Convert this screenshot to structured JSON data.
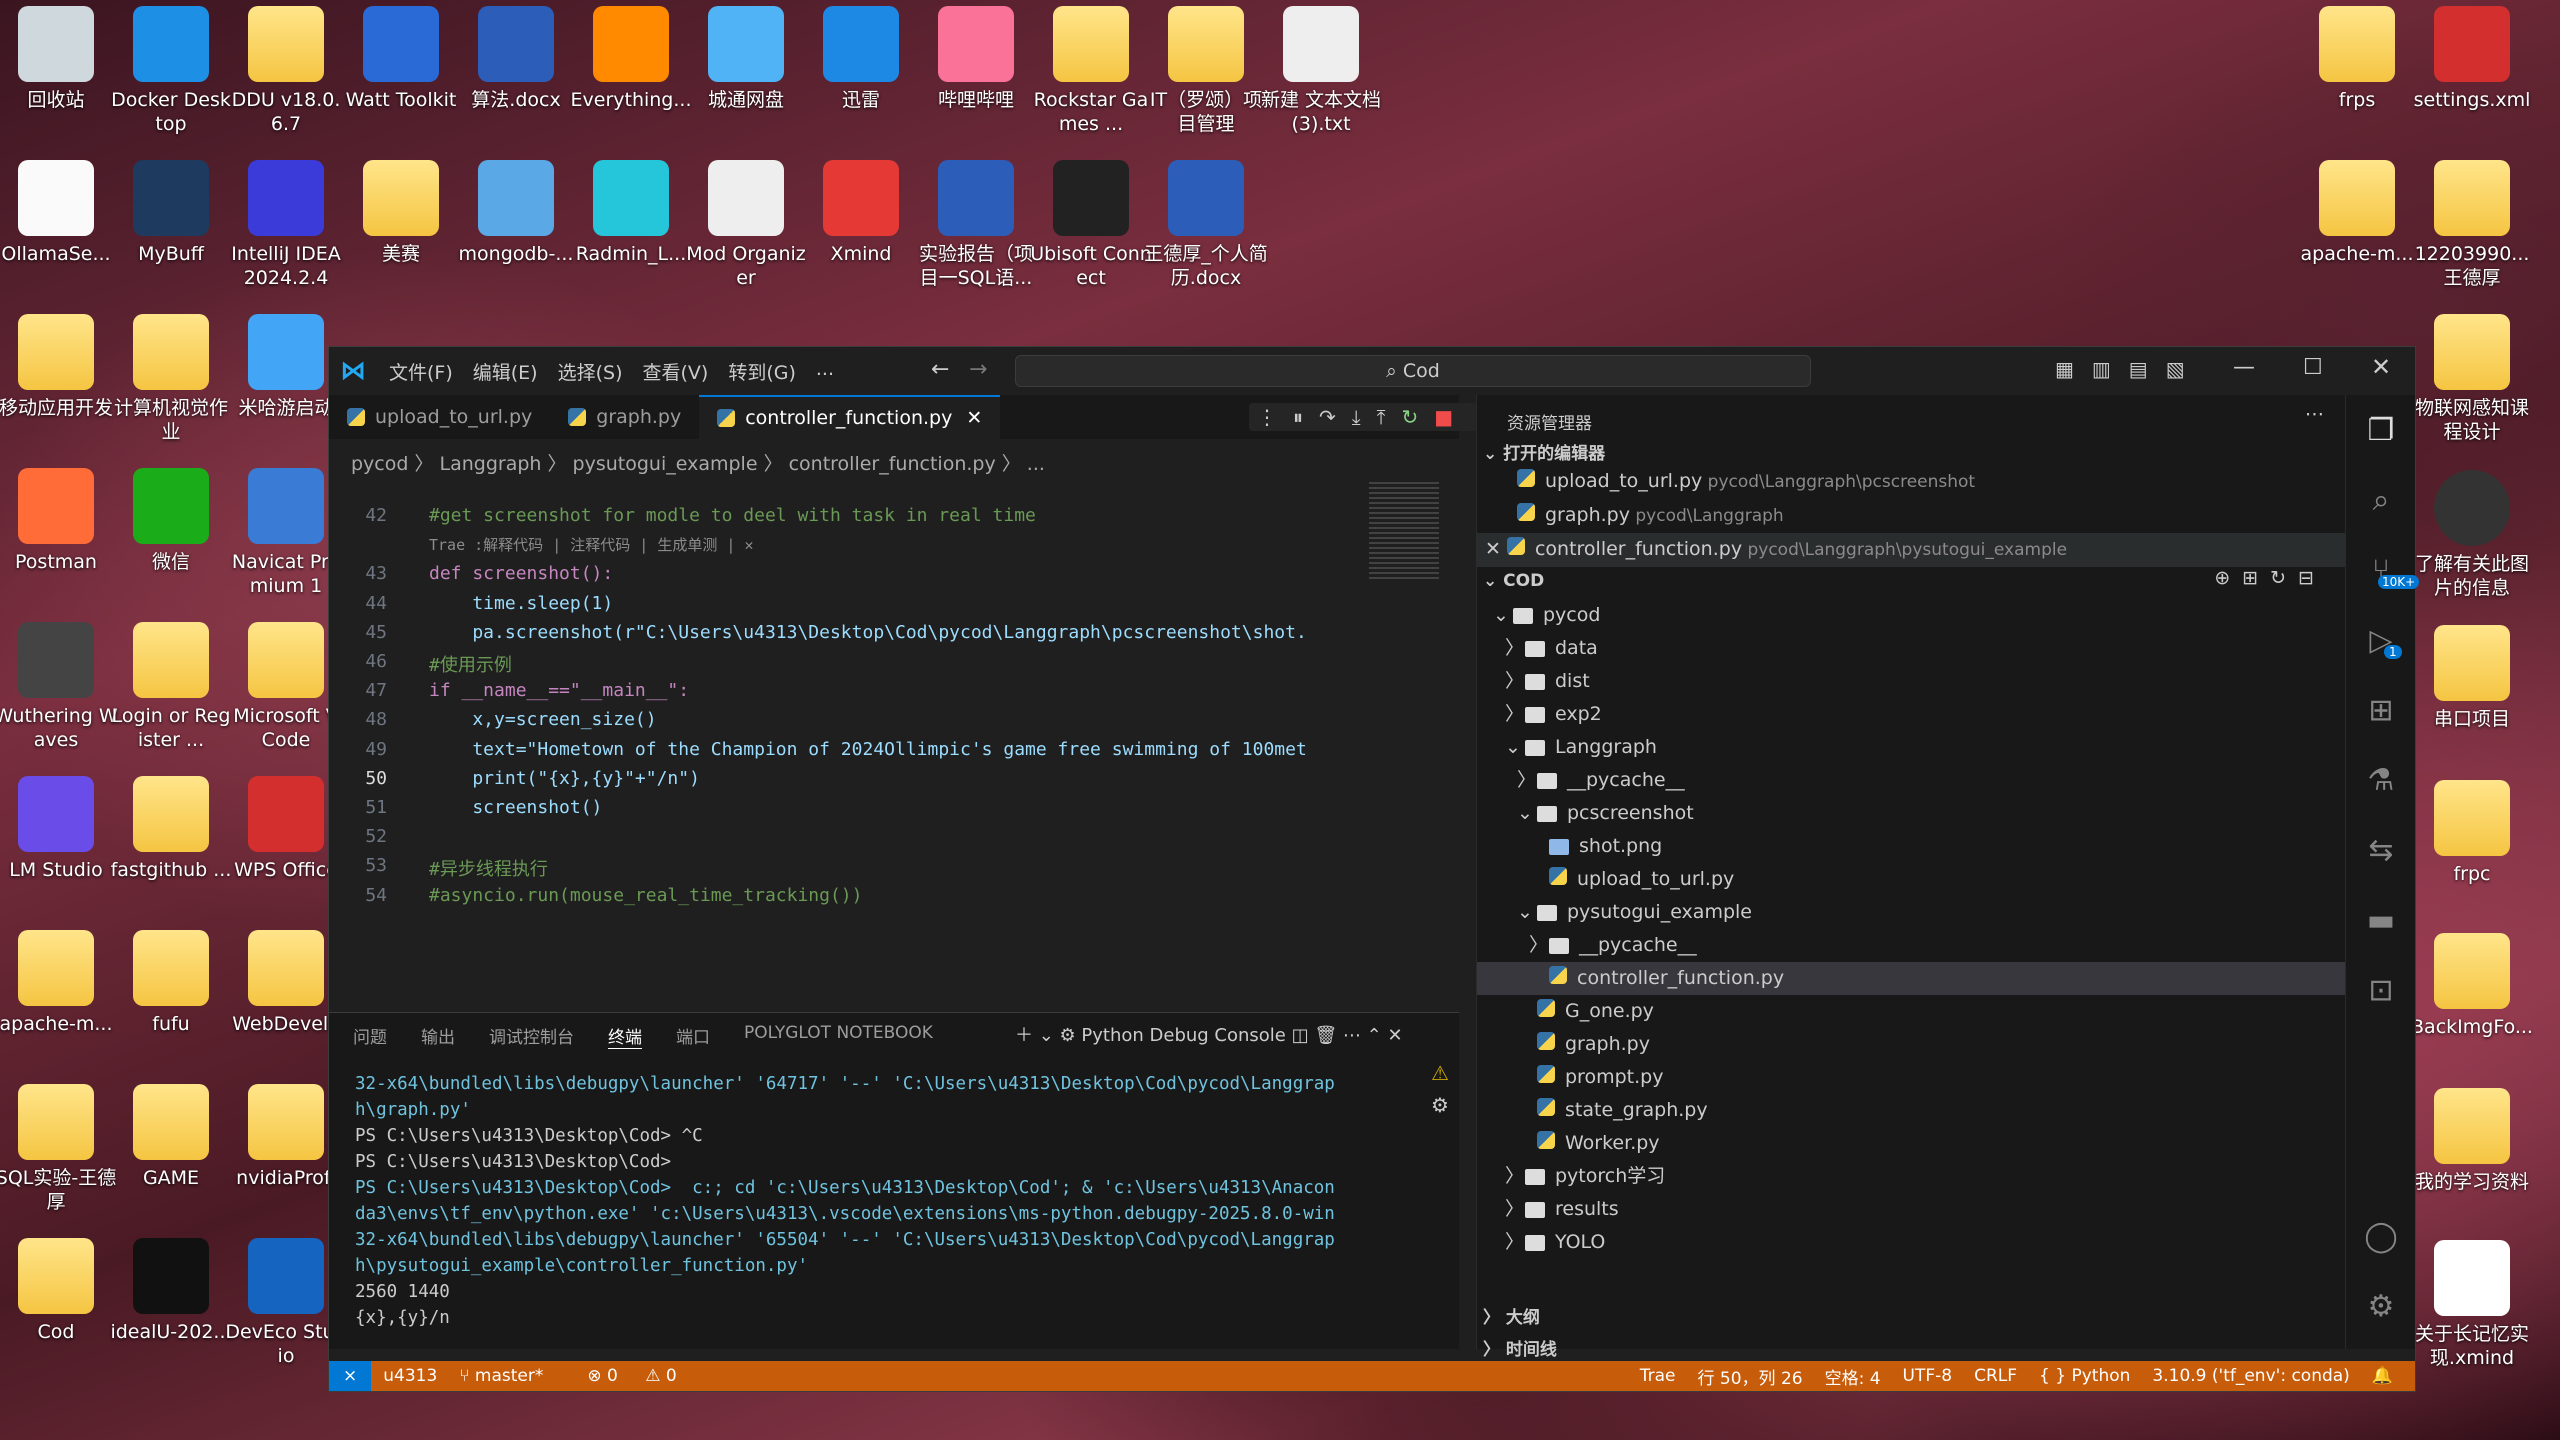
{
  "desktop": {
    "left_icons": [
      {
        "label": "回收站",
        "x": 0,
        "y": 0
      },
      {
        "label": "Docker Desktop"
      },
      {
        "label": "DDU v18.0.6.7"
      },
      {
        "label": "Watt Toolkit"
      },
      {
        "label": "算法.docx"
      },
      {
        "label": "Everything..."
      },
      {
        "label": "城通网盘"
      },
      {
        "label": "迅雷"
      },
      {
        "label": "哔哩哔哩"
      },
      {
        "label": "Rockstar Games ..."
      },
      {
        "label": "IT（罗颂）项目管理"
      },
      {
        "label": "新建 文本文档 (3).txt"
      },
      {
        "label": "OllamaSe..."
      },
      {
        "label": "MyBuff"
      },
      {
        "label": "IntelliJ IDEA 2024.2.4"
      },
      {
        "label": "美赛"
      },
      {
        "label": "mongodb-..."
      },
      {
        "label": "Radmin_L..."
      },
      {
        "label": "Mod Organizer"
      },
      {
        "label": "Xmind"
      },
      {
        "label": "实验报告（项目一SQL语..."
      },
      {
        "label": "Ubisoft Connect"
      },
      {
        "label": "王德厚_个人简历.docx"
      },
      {
        "label": "移动应用开发"
      },
      {
        "label": "计算机视觉作业"
      },
      {
        "label": "米哈游启动"
      },
      {
        "label": "Postman"
      },
      {
        "label": "微信"
      },
      {
        "label": "Navicat Premium 1"
      },
      {
        "label": "Wuthering Waves"
      },
      {
        "label": "Login or Register ..."
      },
      {
        "label": "Microsoft V Code"
      },
      {
        "label": "LM Studio"
      },
      {
        "label": "fastgithub ..."
      },
      {
        "label": "WPS Office"
      },
      {
        "label": "apache-m..."
      },
      {
        "label": "fufu"
      },
      {
        "label": "WebDevelo"
      },
      {
        "label": "SQL实验-王德厚"
      },
      {
        "label": "GAME"
      },
      {
        "label": "nvidiaProfi"
      },
      {
        "label": "Cod"
      },
      {
        "label": "idealU-202..."
      },
      {
        "label": "DevEco Studio"
      }
    ],
    "right_icons": [
      {
        "label": "frps"
      },
      {
        "label": "settings.xml"
      },
      {
        "label": "apache-m..."
      },
      {
        "label": "12203990... 王德厚"
      },
      {
        "label": "物联网感知课程设计"
      },
      {
        "label": "了解有关此图片的信息"
      },
      {
        "label": "串口项目"
      },
      {
        "label": "frpc"
      },
      {
        "label": "BackImgFo..."
      },
      {
        "label": "我的学习资料"
      },
      {
        "label": "关于长记忆实现.xmind"
      }
    ]
  },
  "vscode": {
    "menu": [
      "文件(F)",
      "编辑(E)",
      "选择(S)",
      "查看(V)",
      "转到(G)",
      "..."
    ],
    "search": "Cod",
    "tabs": [
      "upload_to_url.py",
      "graph.py",
      "controller_function.py"
    ],
    "breadcrumb": "pycod 〉 Langgraph 〉 pysutogui_example 〉 controller_function.py 〉 ...",
    "code_lines": [
      {
        "n": "42",
        "t": "#get screenshot for modle to deel with task in real time"
      },
      {
        "n": "",
        "t": "Trae :解释代码 | 注释代码 | 生成单测 | ✕"
      },
      {
        "n": "43",
        "t": "def screenshot():"
      },
      {
        "n": "44",
        "t": "    time.sleep(1)"
      },
      {
        "n": "45",
        "t": "    pa.screenshot(r\"C:\\Users\\u4313\\Desktop\\Cod\\pycod\\Langgraph\\pcscreenshot\\shot."
      },
      {
        "n": "46",
        "t": "#使用示例"
      },
      {
        "n": "47",
        "t": "if __name__==\"__main__\":"
      },
      {
        "n": "48",
        "t": "    x,y=screen_size()"
      },
      {
        "n": "49",
        "t": "    text=\"Hometown of the Champion of 2024Ollimpic's game free swimming of 100met"
      },
      {
        "n": "50",
        "t": "    print(\"{x},{y}\"+\"/n\")"
      },
      {
        "n": "51",
        "t": "    screenshot()"
      },
      {
        "n": "52",
        "t": ""
      },
      {
        "n": "53",
        "t": "#异步线程执行"
      },
      {
        "n": "54",
        "t": "#asyncio.run(mouse_real_time_tracking())"
      }
    ],
    "panel_tabs": [
      "问题",
      "输出",
      "调试控制台",
      "终端",
      "端口",
      "POLYGLOT NOTEBOOK"
    ],
    "debug_console": "Python Debug Console",
    "terminal": [
      "32-x64\\bundled\\libs\\debugpy\\launcher' '64717' '--' 'C:\\Users\\u4313\\Desktop\\Cod\\pycod\\Langgrap",
      "h\\graph.py'",
      "PS C:\\Users\\u4313\\Desktop\\Cod> ^C",
      "PS C:\\Users\\u4313\\Desktop\\Cod>",
      "PS C:\\Users\\u4313\\Desktop\\Cod>  c:; cd 'c:\\Users\\u4313\\Desktop\\Cod'; & 'c:\\Users\\u4313\\Anacon",
      "da3\\envs\\tf_env\\python.exe' 'c:\\Users\\u4313\\.vscode\\extensions\\ms-python.debugpy-2025.8.0-win",
      "32-x64\\bundled\\libs\\debugpy\\launcher' '65504' '--' 'C:\\Users\\u4313\\Desktop\\Cod\\pycod\\Langgrap",
      "h\\pysutogui_example\\controller_function.py'",
      "2560 1440",
      "{x},{y}/n"
    ],
    "explorer": {
      "title": "资源管理器",
      "open_editors": "打开的编辑器",
      "open": [
        {
          "name": "upload_to_url.py",
          "path": "pycod\\Langgraph\\pcscreenshot"
        },
        {
          "name": "graph.py",
          "path": "pycod\\Langgraph"
        },
        {
          "name": "controller_function.py",
          "path": "pycod\\Langgraph\\pysutogui_example"
        }
      ],
      "root": "COD",
      "tree": [
        {
          "d": 1,
          "c": "v",
          "k": "folder",
          "n": "pycod"
        },
        {
          "d": 2,
          "c": ">",
          "k": "folder",
          "n": "data"
        },
        {
          "d": 2,
          "c": ">",
          "k": "folder",
          "n": "dist"
        },
        {
          "d": 2,
          "c": ">",
          "k": "folder",
          "n": "exp2"
        },
        {
          "d": 2,
          "c": "v",
          "k": "folder",
          "n": "Langgraph"
        },
        {
          "d": 3,
          "c": ">",
          "k": "folder",
          "n": "__pycache__"
        },
        {
          "d": 3,
          "c": "v",
          "k": "folder",
          "n": "pcscreenshot"
        },
        {
          "d": 4,
          "c": "",
          "k": "img",
          "n": "shot.png"
        },
        {
          "d": 4,
          "c": "",
          "k": "py",
          "n": "upload_to_url.py"
        },
        {
          "d": 3,
          "c": "v",
          "k": "folder",
          "n": "pysutogui_example"
        },
        {
          "d": 4,
          "c": ">",
          "k": "folder",
          "n": "__pycache__"
        },
        {
          "d": 4,
          "c": "",
          "k": "py",
          "n": "controller_function.py",
          "sel": true
        },
        {
          "d": 3,
          "c": "",
          "k": "py",
          "n": "G_one.py"
        },
        {
          "d": 3,
          "c": "",
          "k": "py",
          "n": "graph.py"
        },
        {
          "d": 3,
          "c": "",
          "k": "py",
          "n": "prompt.py"
        },
        {
          "d": 3,
          "c": "",
          "k": "py",
          "n": "state_graph.py"
        },
        {
          "d": 3,
          "c": "",
          "k": "py",
          "n": "Worker.py"
        },
        {
          "d": 2,
          "c": ">",
          "k": "folder",
          "n": "pytorch学习"
        },
        {
          "d": 2,
          "c": ">",
          "k": "folder",
          "n": "results"
        },
        {
          "d": 2,
          "c": ">",
          "k": "folder",
          "n": "YOLO"
        }
      ],
      "outline": "大纲",
      "timeline": "时间线"
    },
    "badges": {
      "source_control": "10K+",
      "debug": "1"
    },
    "status": {
      "user": "u4313",
      "branch": "master*",
      "errors": "0",
      "warnings": "0",
      "trae": "Trae",
      "position": "行 50，列 26",
      "spaces": "空格: 4",
      "encoding": "UTF-8",
      "eol": "CRLF",
      "lang": "{ } Python",
      "interp": "3.10.9 ('tf_env': conda)"
    },
    "accent": "#0078d4",
    "statusbar_color": "#c75c0a"
  }
}
